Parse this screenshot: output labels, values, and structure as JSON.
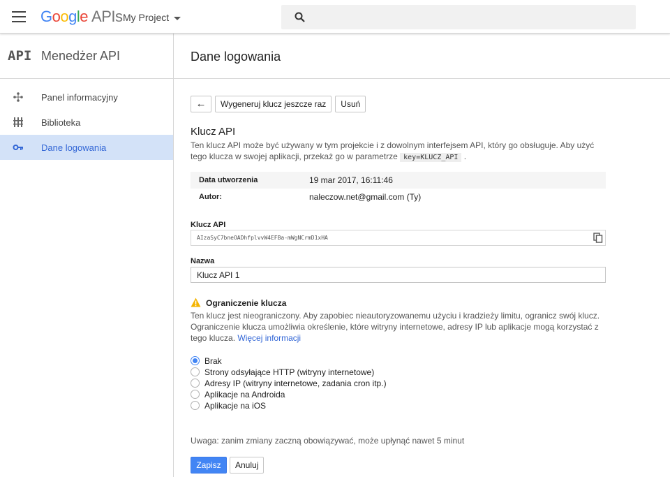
{
  "header": {
    "logo_letters": [
      "G",
      "o",
      "o",
      "g",
      "l",
      "e"
    ],
    "logo_suffix": "APIs",
    "project": "My Project",
    "menu_icon": "hamburger-menu-icon",
    "search_icon": "search-icon"
  },
  "sidebar": {
    "logo": "API",
    "title": "Menedżer API",
    "items": [
      {
        "label": "Panel informacyjny",
        "icon": "dashboard-icon",
        "active": false
      },
      {
        "label": "Biblioteka",
        "icon": "library-icon",
        "active": false
      },
      {
        "label": "Dane logowania",
        "icon": "key-icon",
        "active": true
      }
    ]
  },
  "main": {
    "title": "Dane logowania",
    "toolbar": {
      "back_label": "←",
      "regenerate_label": "Wygeneruj klucz jeszcze raz",
      "delete_label": "Usuń"
    },
    "key_heading": "Klucz API",
    "description_part1": "Ten klucz API może być używany w tym projekcie i z dowolnym interfejsem API, który go obsługuje. Aby użyć tego klucza w swojej aplikacji, przekaż go w parametrze",
    "description_code": "key=KLUCZ_API",
    "description_part2": ".",
    "meta": {
      "created_label": "Data utworzenia",
      "created_value": "19 mar 2017, 16:11:46",
      "author_label": "Autor:",
      "author_value": "naleczow.net@gmail.com (Ty)"
    },
    "api_key_label": "Klucz API",
    "api_key_value": "AIzaSyC7bneOADhfplvvW4EFBa-mWgNCrmD1xHA",
    "name_label": "Nazwa",
    "name_value": "Klucz API 1",
    "restriction": {
      "heading": "Ograniczenie klucza",
      "text": "Ten klucz jest nieograniczony. Aby zapobiec nieautoryzowanemu użyciu i kradzieży limitu, ogranicz swój klucz. Ograniczenie klucza umożliwia określenie, które witryny internetowe, adresy IP lub aplikacje mogą korzystać z tego klucza.",
      "link": "Więcej informacji",
      "options": [
        {
          "label": "Brak",
          "selected": true
        },
        {
          "label": "Strony odsyłające HTTP (witryny internetowe)",
          "selected": false
        },
        {
          "label": "Adresy IP (witryny internetowe, zadania cron itp.)",
          "selected": false
        },
        {
          "label": "Aplikacje na Androida",
          "selected": false
        },
        {
          "label": "Aplikacje na iOS",
          "selected": false
        }
      ]
    },
    "note": "Uwaga: zanim zmiany zaczną obowiązywać, może upłynąć nawet 5 minut",
    "save_label": "Zapisz",
    "cancel_label": "Anuluj"
  },
  "colors": {
    "accent": "#4285f4",
    "active_bg": "#d3e2f8",
    "link": "#3367d6",
    "warning": "#f4b400"
  }
}
